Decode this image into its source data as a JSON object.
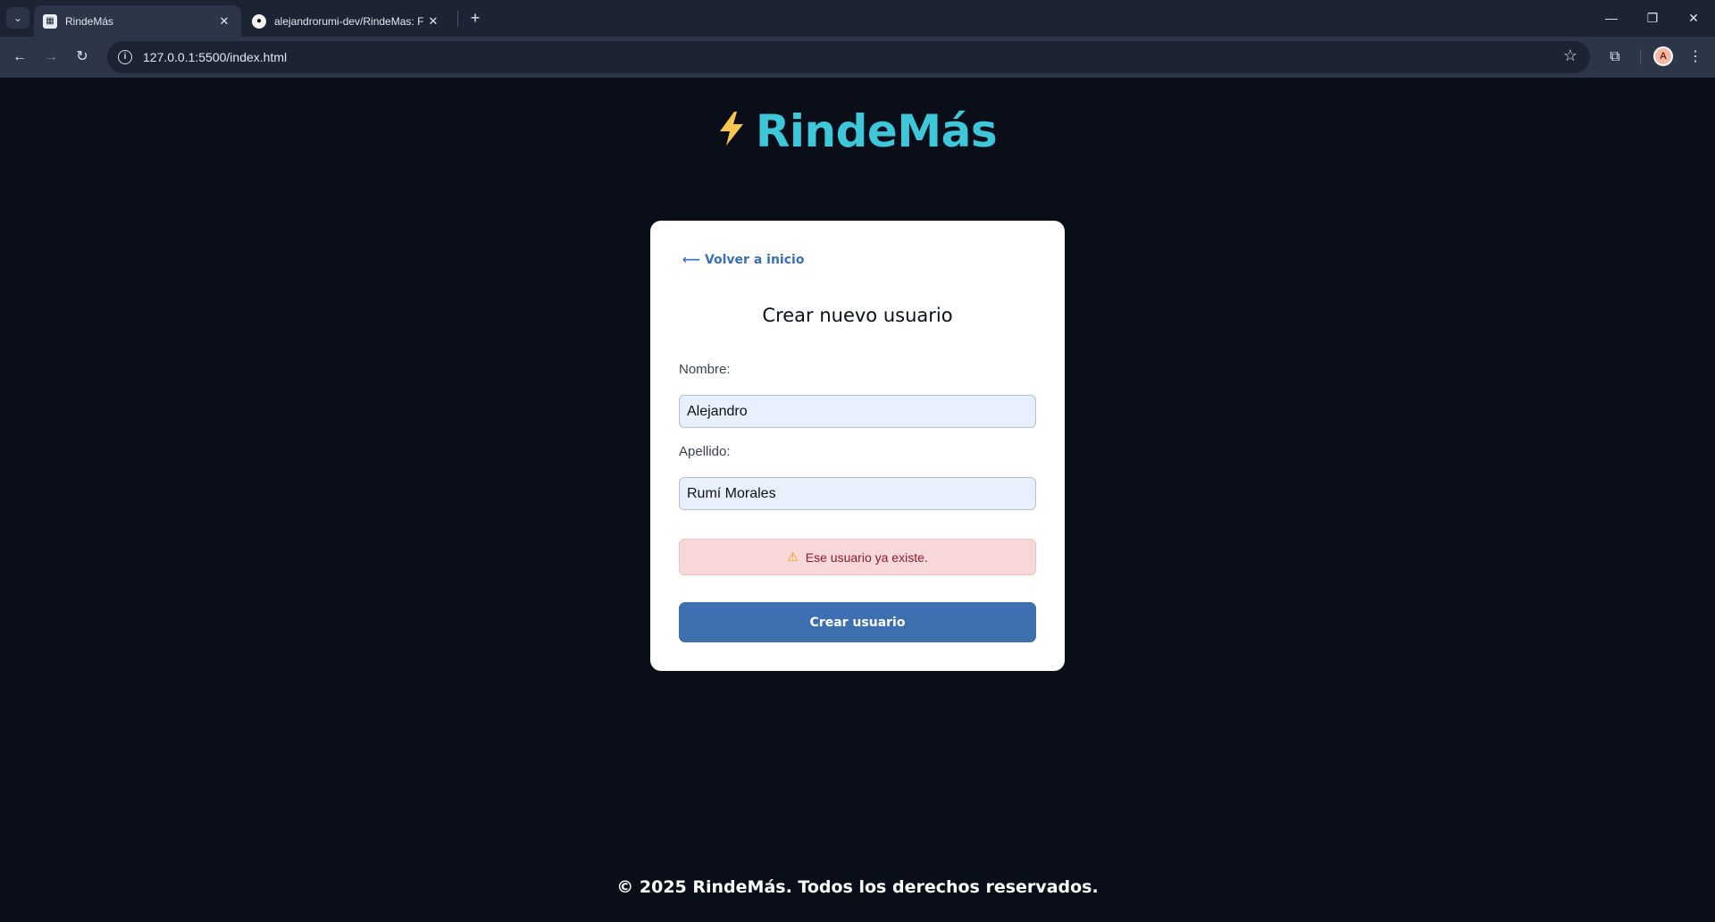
{
  "browser": {
    "tabs": [
      {
        "title": "RindeMás",
        "favicon": "page-favicon-icon",
        "active": true
      },
      {
        "title": "alejandrorumi-dev/RindeMas: F",
        "favicon": "github-icon",
        "active": false
      }
    ],
    "url": "127.0.0.1:5500/index.html",
    "avatar_initial": "A"
  },
  "brand": {
    "icon": "bolt-icon",
    "name": "RindeMás",
    "color": "#3ec7d8"
  },
  "form": {
    "back_link": "⟵ Volver a inicio",
    "title": "Crear nuevo usuario",
    "first_name_label": "Nombre:",
    "first_name_value": "Alejandro",
    "last_name_label": "Apellido:",
    "last_name_value": "Rumí Morales",
    "error_message": "Ese usuario ya existe.",
    "submit_label": "Crear usuario"
  },
  "footer": {
    "text": "© 2025 RindeMás. Todos los derechos reservados."
  },
  "colors": {
    "background": "#0a0e18",
    "accent": "#3e6fb0",
    "error_bg": "#f8d7da",
    "bolt": "#f9c74f"
  }
}
